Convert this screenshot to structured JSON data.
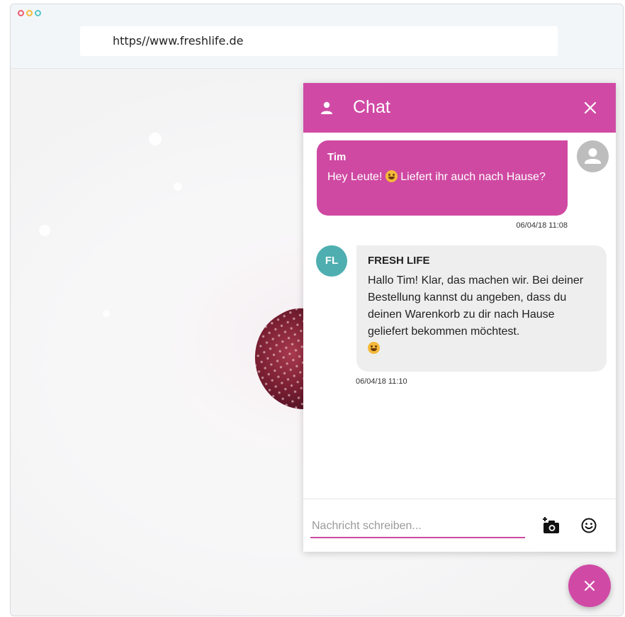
{
  "browser": {
    "url": "https//www.freshlife.de",
    "dot_colors": [
      "#f05a6e",
      "#f4b942",
      "#57c6c8"
    ]
  },
  "chat": {
    "title": "Chat",
    "accent_color": "#d04aa5",
    "messages": [
      {
        "sender": "Tim",
        "text_before_emoji": "Hey Leute! ",
        "emoji": "smiling-face-icon",
        "text_after_emoji": " Liefert ihr auch nach Hause?",
        "timestamp": "06/04/18 11:08"
      },
      {
        "sender": "FRESH LIFE",
        "avatar_initials": "FL",
        "avatar_color": "#4eaeb0",
        "text": "Hallo Tim! Klar, das machen wir. Bei deiner Bestellung kannst du angeben, dass du deinen Warenkorb zu dir nach Hause geliefert bekommen möchtest.",
        "emoji": "winking-face-icon",
        "timestamp": "06/04/18 11:10"
      }
    ],
    "input_placeholder": "Nachricht schreiben..."
  }
}
